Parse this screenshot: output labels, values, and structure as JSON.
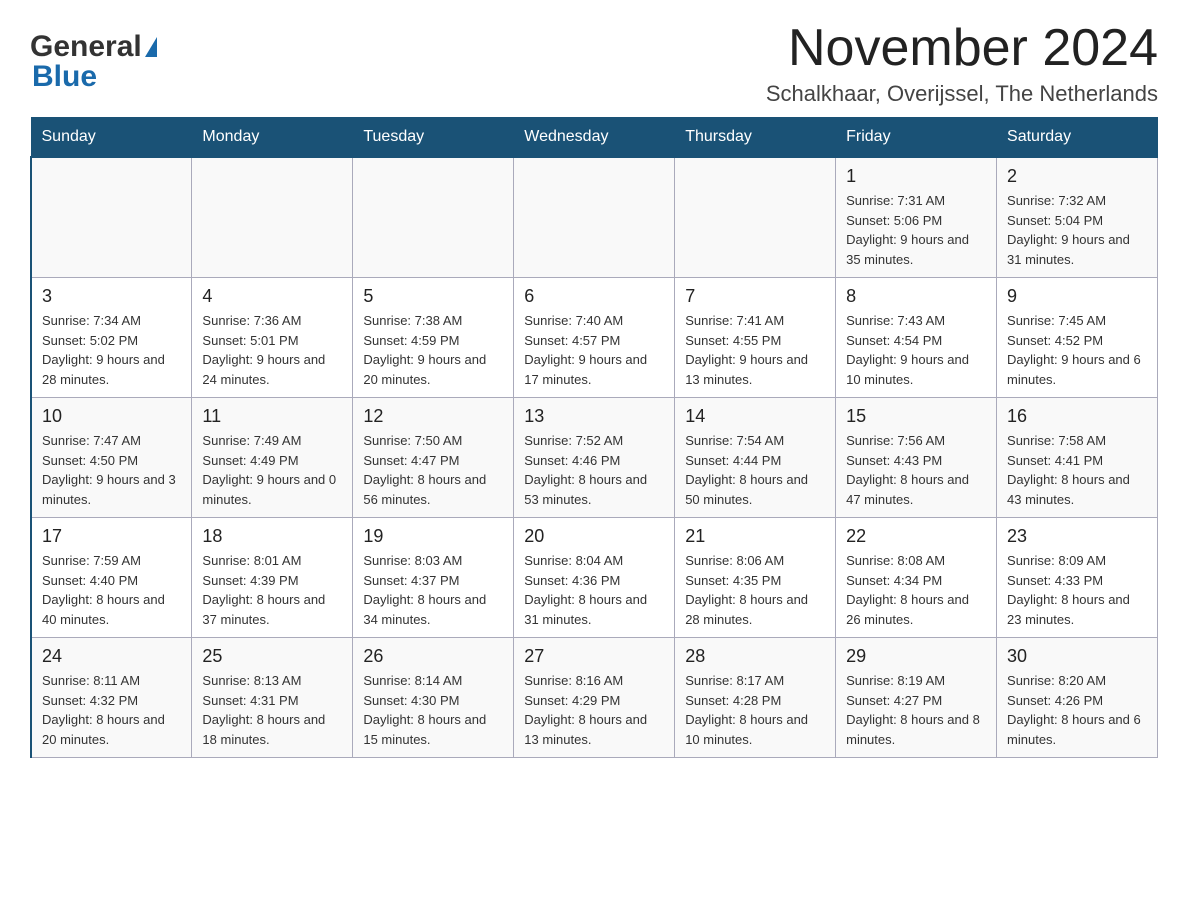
{
  "header": {
    "logo_general": "General",
    "logo_blue": "Blue",
    "month_title": "November 2024",
    "location": "Schalkhaar, Overijssel, The Netherlands"
  },
  "days_of_week": [
    "Sunday",
    "Monday",
    "Tuesday",
    "Wednesday",
    "Thursday",
    "Friday",
    "Saturday"
  ],
  "weeks": [
    [
      {
        "day": "",
        "info": ""
      },
      {
        "day": "",
        "info": ""
      },
      {
        "day": "",
        "info": ""
      },
      {
        "day": "",
        "info": ""
      },
      {
        "day": "",
        "info": ""
      },
      {
        "day": "1",
        "info": "Sunrise: 7:31 AM\nSunset: 5:06 PM\nDaylight: 9 hours and 35 minutes."
      },
      {
        "day": "2",
        "info": "Sunrise: 7:32 AM\nSunset: 5:04 PM\nDaylight: 9 hours and 31 minutes."
      }
    ],
    [
      {
        "day": "3",
        "info": "Sunrise: 7:34 AM\nSunset: 5:02 PM\nDaylight: 9 hours and 28 minutes."
      },
      {
        "day": "4",
        "info": "Sunrise: 7:36 AM\nSunset: 5:01 PM\nDaylight: 9 hours and 24 minutes."
      },
      {
        "day": "5",
        "info": "Sunrise: 7:38 AM\nSunset: 4:59 PM\nDaylight: 9 hours and 20 minutes."
      },
      {
        "day": "6",
        "info": "Sunrise: 7:40 AM\nSunset: 4:57 PM\nDaylight: 9 hours and 17 minutes."
      },
      {
        "day": "7",
        "info": "Sunrise: 7:41 AM\nSunset: 4:55 PM\nDaylight: 9 hours and 13 minutes."
      },
      {
        "day": "8",
        "info": "Sunrise: 7:43 AM\nSunset: 4:54 PM\nDaylight: 9 hours and 10 minutes."
      },
      {
        "day": "9",
        "info": "Sunrise: 7:45 AM\nSunset: 4:52 PM\nDaylight: 9 hours and 6 minutes."
      }
    ],
    [
      {
        "day": "10",
        "info": "Sunrise: 7:47 AM\nSunset: 4:50 PM\nDaylight: 9 hours and 3 minutes."
      },
      {
        "day": "11",
        "info": "Sunrise: 7:49 AM\nSunset: 4:49 PM\nDaylight: 9 hours and 0 minutes."
      },
      {
        "day": "12",
        "info": "Sunrise: 7:50 AM\nSunset: 4:47 PM\nDaylight: 8 hours and 56 minutes."
      },
      {
        "day": "13",
        "info": "Sunrise: 7:52 AM\nSunset: 4:46 PM\nDaylight: 8 hours and 53 minutes."
      },
      {
        "day": "14",
        "info": "Sunrise: 7:54 AM\nSunset: 4:44 PM\nDaylight: 8 hours and 50 minutes."
      },
      {
        "day": "15",
        "info": "Sunrise: 7:56 AM\nSunset: 4:43 PM\nDaylight: 8 hours and 47 minutes."
      },
      {
        "day": "16",
        "info": "Sunrise: 7:58 AM\nSunset: 4:41 PM\nDaylight: 8 hours and 43 minutes."
      }
    ],
    [
      {
        "day": "17",
        "info": "Sunrise: 7:59 AM\nSunset: 4:40 PM\nDaylight: 8 hours and 40 minutes."
      },
      {
        "day": "18",
        "info": "Sunrise: 8:01 AM\nSunset: 4:39 PM\nDaylight: 8 hours and 37 minutes."
      },
      {
        "day": "19",
        "info": "Sunrise: 8:03 AM\nSunset: 4:37 PM\nDaylight: 8 hours and 34 minutes."
      },
      {
        "day": "20",
        "info": "Sunrise: 8:04 AM\nSunset: 4:36 PM\nDaylight: 8 hours and 31 minutes."
      },
      {
        "day": "21",
        "info": "Sunrise: 8:06 AM\nSunset: 4:35 PM\nDaylight: 8 hours and 28 minutes."
      },
      {
        "day": "22",
        "info": "Sunrise: 8:08 AM\nSunset: 4:34 PM\nDaylight: 8 hours and 26 minutes."
      },
      {
        "day": "23",
        "info": "Sunrise: 8:09 AM\nSunset: 4:33 PM\nDaylight: 8 hours and 23 minutes."
      }
    ],
    [
      {
        "day": "24",
        "info": "Sunrise: 8:11 AM\nSunset: 4:32 PM\nDaylight: 8 hours and 20 minutes."
      },
      {
        "day": "25",
        "info": "Sunrise: 8:13 AM\nSunset: 4:31 PM\nDaylight: 8 hours and 18 minutes."
      },
      {
        "day": "26",
        "info": "Sunrise: 8:14 AM\nSunset: 4:30 PM\nDaylight: 8 hours and 15 minutes."
      },
      {
        "day": "27",
        "info": "Sunrise: 8:16 AM\nSunset: 4:29 PM\nDaylight: 8 hours and 13 minutes."
      },
      {
        "day": "28",
        "info": "Sunrise: 8:17 AM\nSunset: 4:28 PM\nDaylight: 8 hours and 10 minutes."
      },
      {
        "day": "29",
        "info": "Sunrise: 8:19 AM\nSunset: 4:27 PM\nDaylight: 8 hours and 8 minutes."
      },
      {
        "day": "30",
        "info": "Sunrise: 8:20 AM\nSunset: 4:26 PM\nDaylight: 8 hours and 6 minutes."
      }
    ]
  ]
}
